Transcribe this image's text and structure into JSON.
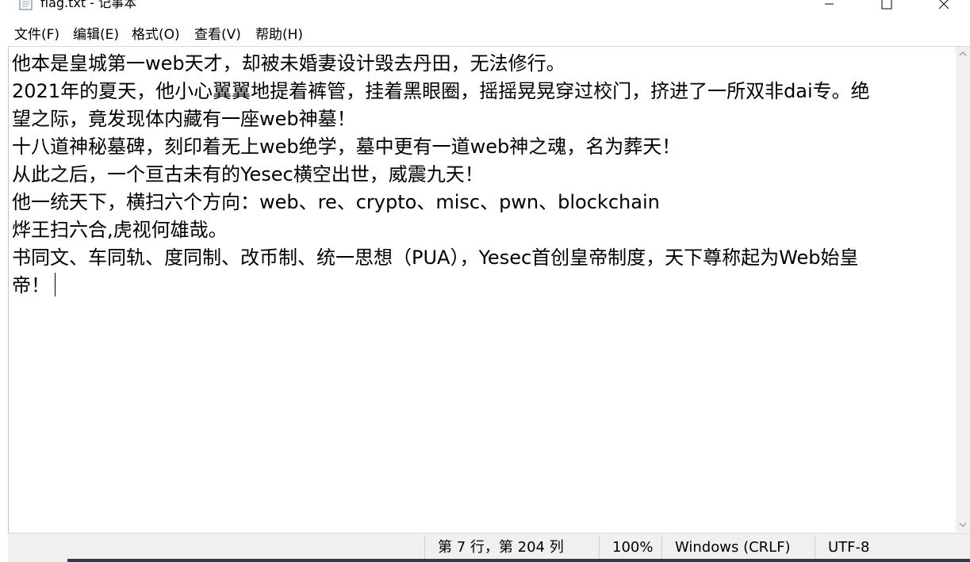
{
  "window": {
    "title": "flag.txt - 记事本",
    "icon": "notepad-icon",
    "controls": [
      "minimize-icon",
      "maximize-icon",
      "close-icon"
    ]
  },
  "menu": {
    "file": "文件(F)",
    "edit": "编辑(E)",
    "format": "格式(O)",
    "view": "查看(V)",
    "help": "帮助(H)"
  },
  "document": {
    "lines": [
      "他本是皇城第一web天才，却被未婚妻设计毁去丹田，无法修行。",
      "2021年的夏天，他小心翼翼地提着裤管，挂着黑眼圈，摇摇晃晃穿过校门，挤进了一所双非dai专。绝",
      "望之际，竟发现体内藏有一座web神墓！",
      "十八道神秘墓碑，刻印着无上web绝学，墓中更有一道web神之魂，名为葬天！",
      "从此之后，一个亘古未有的Yesec横空出世，威震九天！",
      "他一统天下，横扫六个方向：web、re、crypto、misc、pwn、blockchain",
      "烨王扫六合,虎视何雄哉。",
      "书同文、车同轨、度同制、改币制、统一思想（PUA），Yesec首创皇帝制度，天下尊称起为Web始皇",
      "帝！"
    ]
  },
  "status": {
    "position": "第 7 行，第 204 列",
    "zoom": "100%",
    "line_ending": "Windows (CRLF)",
    "encoding": "UTF-8"
  }
}
